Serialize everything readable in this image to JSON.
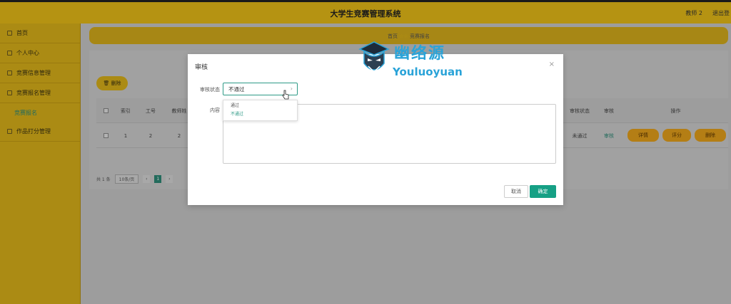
{
  "header": {
    "title": "大学生竞赛管理系统",
    "user": "教师 2",
    "logout": "退出登"
  },
  "sidebar": {
    "items": [
      {
        "label": "首页"
      },
      {
        "label": "个人中心"
      },
      {
        "label": "竞赛信息管理"
      },
      {
        "label": "竞赛报名管理"
      }
    ],
    "subitem": {
      "label": "竞赛报名"
    },
    "last_item": {
      "label": "作品打分管理"
    }
  },
  "breadcrumb": {
    "home": "首页",
    "current": "竞赛报名"
  },
  "toolbar": {
    "delete_label": "删除"
  },
  "table": {
    "headers": {
      "index": "索引",
      "job_no": "工号",
      "teacher": "教师姓",
      "review_status": "审核状态",
      "review": "审核",
      "actions": "操作"
    },
    "row": {
      "index": "1",
      "job_no": "2",
      "teacher": "2",
      "review_status": "未通过",
      "review_link": "审核"
    },
    "buttons": {
      "detail": "详情",
      "grade": "评分",
      "delete": "删除"
    }
  },
  "pagination": {
    "total": "共 1 条",
    "page_size": "10条/页",
    "current_page": "1"
  },
  "dialog": {
    "title": "审核",
    "close": "×",
    "status_label": "审核状态",
    "status_value": "不通过",
    "content_label": "内容",
    "options": [
      "通过",
      "不通过"
    ],
    "cancel": "取消",
    "ok": "确定"
  },
  "watermark": {
    "cn": "幽络源",
    "en": "Youluoyuan"
  },
  "colors": {
    "brand": "#e8bd18",
    "sidebar": "#dcb21a",
    "accent": "#16a085",
    "op_button": "#e7a21c"
  }
}
